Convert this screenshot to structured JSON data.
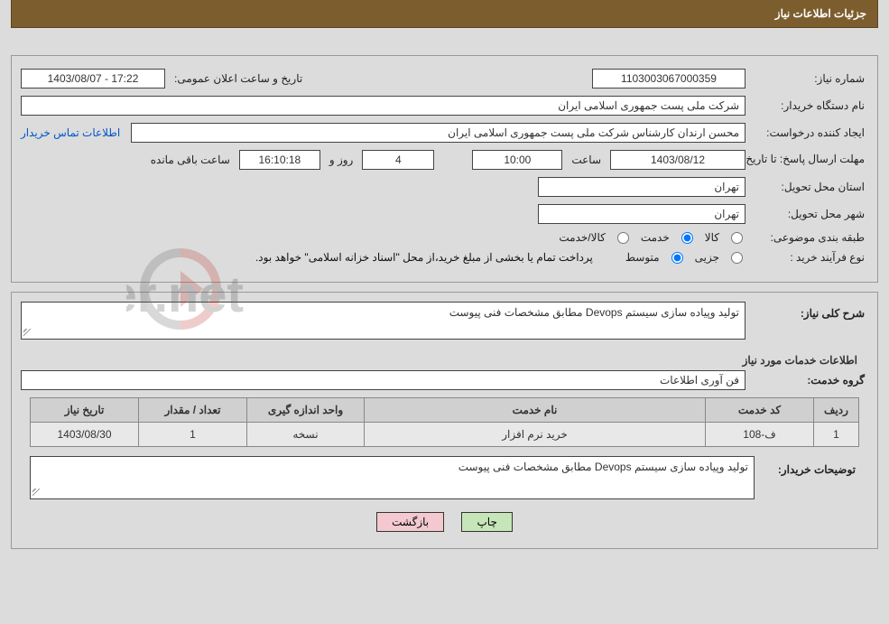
{
  "header": {
    "title": "جزئیات اطلاعات نیاز"
  },
  "labels": {
    "need_no": "شماره نیاز:",
    "buyer_org": "نام دستگاه خریدار:",
    "requester": "ایجاد کننده درخواست:",
    "contact_link": "اطلاعات تماس خریدار",
    "deadline": "مهلت ارسال پاسخ: تا تاریخ:",
    "announce_datetime": "تاریخ و ساعت اعلان عمومی:",
    "hour_word": "ساعت",
    "day_and": "روز و",
    "remaining": "ساعت باقی مانده",
    "province": "استان محل تحویل:",
    "city": "شهر محل تحویل:",
    "category": "طبقه بندی موضوعی:",
    "cat_goods": "کالا",
    "cat_service": "خدمت",
    "cat_both": "کالا/خدمت",
    "purchase_type": "نوع فرآیند خرید :",
    "pt_partial": "جزیی",
    "pt_medium": "متوسط",
    "payment_note": "پرداخت تمام یا بخشی از مبلغ خرید،از محل \"اسناد خزانه اسلامی\" خواهد بود.",
    "overall_desc": "شرح کلی نیاز:",
    "services_info": "اطلاعات خدمات مورد نیاز",
    "service_group": "گروه خدمت:",
    "buyer_notes": "توضیحات خریدار:"
  },
  "values": {
    "need_no": "1103003067000359",
    "buyer_org": "شرکت ملی پست جمهوری اسلامی ایران",
    "requester": "محسن ارندان کارشناس شرکت ملی پست جمهوری اسلامی ایران",
    "deadline_date": "1403/08/12",
    "deadline_time": "10:00",
    "days_left": "4",
    "time_left": "16:10:18",
    "announce": "1403/08/07 - 17:22",
    "province": "تهران",
    "city": "تهران",
    "overall_desc": "تولید وپیاده سازی سیستم  Devops مطابق مشخصات فنی پیوست",
    "service_group": "فن آوری اطلاعات",
    "buyer_notes": "تولید وپیاده سازی سیستم  Devops مطابق مشخصات فنی پیوست"
  },
  "category_selected": "service",
  "purchase_selected": "medium",
  "table": {
    "headers": {
      "row": "ردیف",
      "code": "کد خدمت",
      "name": "نام خدمت",
      "unit": "واحد اندازه گیری",
      "qty": "تعداد / مقدار",
      "date": "تاریخ نیاز"
    },
    "rows": [
      {
        "row": "1",
        "code": "ف-108",
        "name": "خرید نرم افزار",
        "unit": "نسخه",
        "qty": "1",
        "date": "1403/08/30"
      }
    ]
  },
  "buttons": {
    "print": "چاپ",
    "back": "بازگشت"
  },
  "watermark_text": "AriaTender.net"
}
